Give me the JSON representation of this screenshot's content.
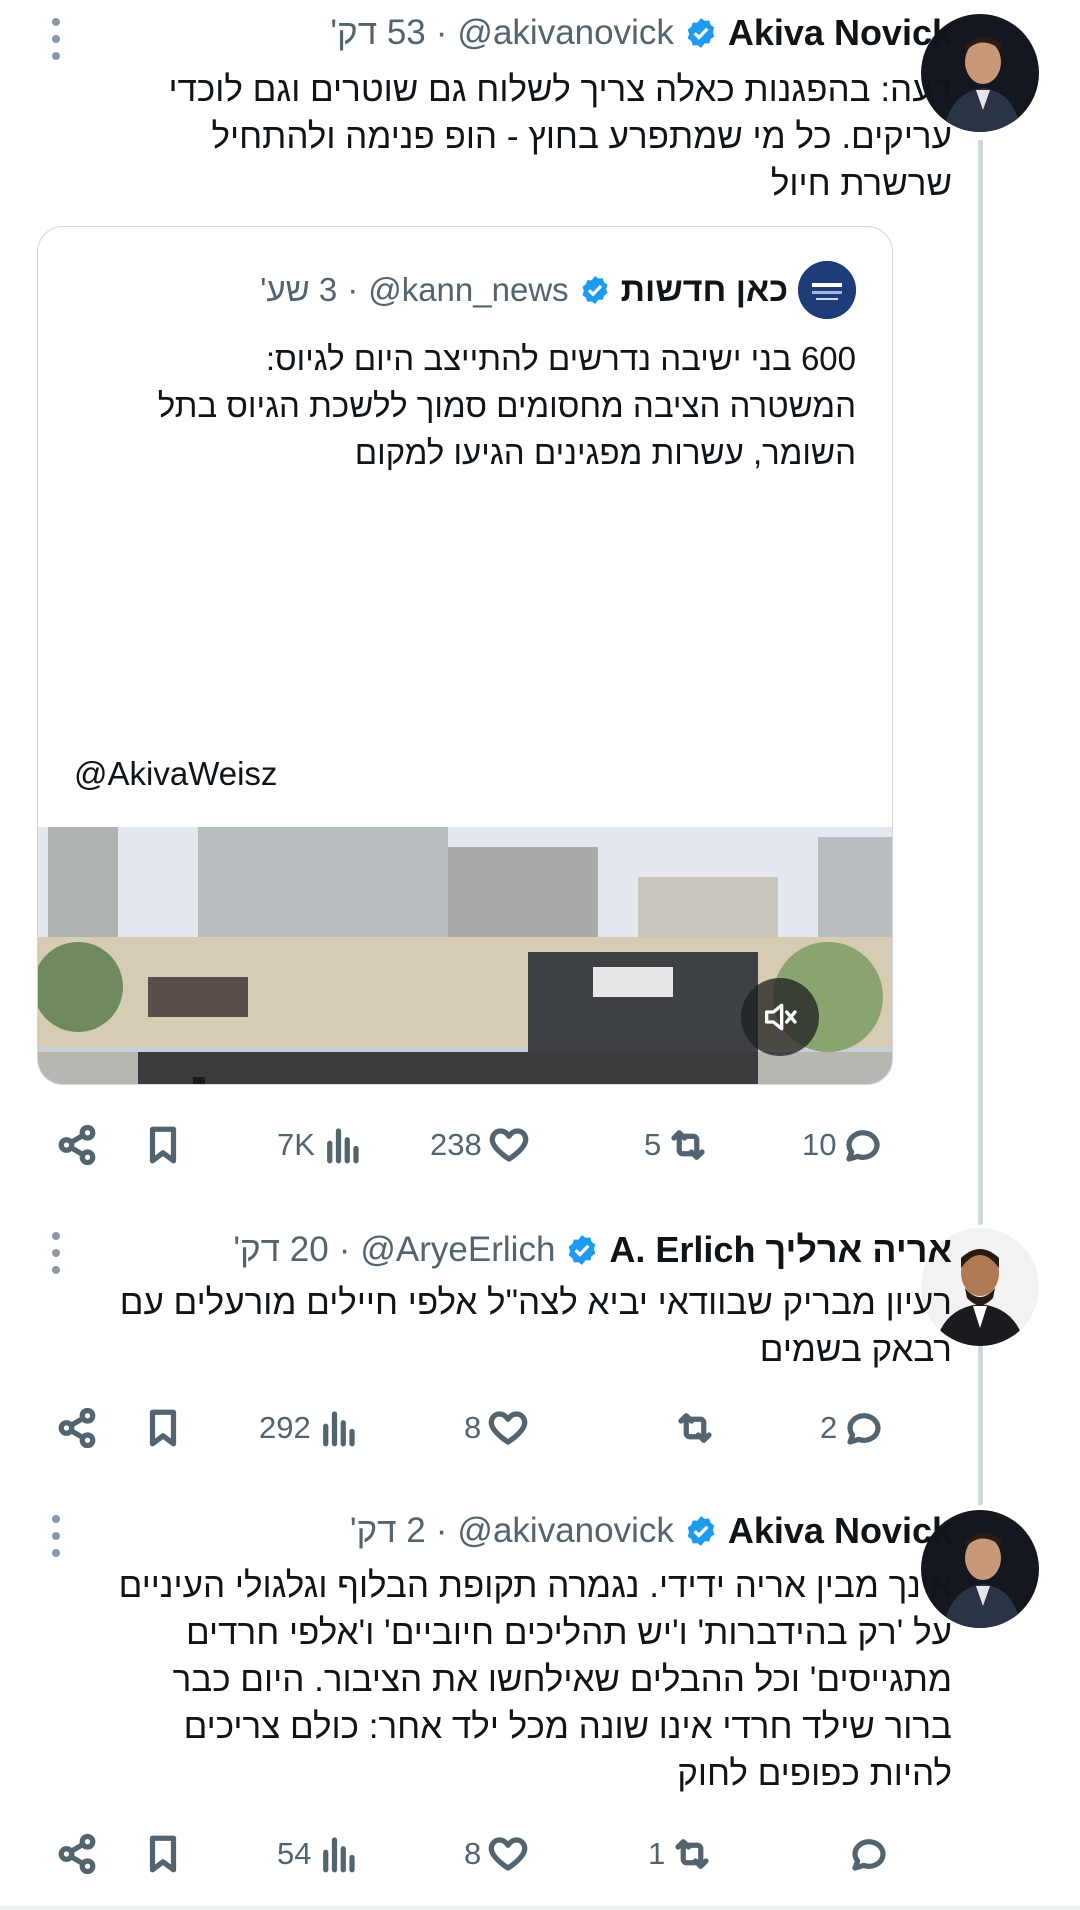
{
  "tweets": [
    {
      "name": "Akiva Novick",
      "handle": "@akivanovick",
      "time": "53 דק'",
      "text": "דעה: בהפגנות כאלה צריך לשלוח גם שוטרים וגם לוכדי עריקים. כל מי שמתפרע בחוץ - הופ פנימה ולהתחיל שרשרת חיול",
      "quote": {
        "name": "כאן חדשות",
        "handle": "@kann_news",
        "time": "3 שע'",
        "text": "600 בני ישיבה נדרשים להתייצב היום לגיוס:\nהמשטרה הציבה מחסומים סמוך ללשכת הגיוס בתל השומר, עשרות מפגינים הגיעו למקום",
        "mention": "@AkivaWeisz"
      },
      "stats": {
        "views": "7K",
        "likes": "238",
        "retweets": "5",
        "replies": "10"
      }
    },
    {
      "name": "אריה ארליך A. Erlich",
      "handle": "@AryeErlich",
      "time": "20 דק'",
      "text": "רעיון מבריק שבוודאי יביא לצה\"ל אלפי חיילים מורעלים עם רבאק בשמים",
      "stats": {
        "views": "292",
        "likes": "8",
        "retweets": "",
        "replies": "2"
      }
    },
    {
      "name": "Akiva Novick",
      "handle": "@akivanovick",
      "time": "2 דק'",
      "text": "אינך מבין אריה ידידי. נגמרה תקופת הבלוף וגלגולי העיניים על 'רק בהידברות' ו'יש תהליכים חיוביים' ו'אלפי חרדים מתגייסים' וכל ההבלים שאילחשו את הציבור. היום כבר ברור שילד חרדי אינו שונה מכל ילד אחר: כולם צריכים להיות כפופים לחוק",
      "stats": {
        "views": "54",
        "likes": "8",
        "retweets": "1",
        "replies": ""
      }
    }
  ],
  "colors": {
    "verified": "#1d9bf0",
    "muted": "#536471",
    "line": "#cfd9de"
  },
  "icons": [
    "share-icon",
    "bookmark-icon",
    "views-icon",
    "like-icon",
    "retweet-icon",
    "reply-icon",
    "mute-icon",
    "verified-icon",
    "more-icon"
  ]
}
